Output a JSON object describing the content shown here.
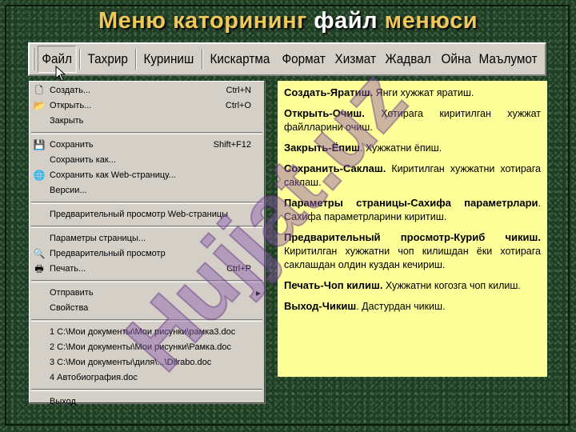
{
  "slide_title": {
    "part1": "Меню  каторининг",
    "part2": "файл",
    "part3": "менюси"
  },
  "menubar": {
    "items": [
      "Файл",
      "Тахрир",
      "Куриниш",
      "Кискартма",
      "Формат",
      "Хизмат",
      "Жадвал",
      "Ойна",
      "Маълумот"
    ]
  },
  "dropdown": {
    "groups": [
      [
        {
          "label": "Создать...",
          "shortcut": "Ctrl+N",
          "icon": "new-document-icon",
          "glyph": "🗋"
        },
        {
          "label": "Открыть...",
          "shortcut": "Ctrl+O",
          "icon": "open-folder-icon",
          "glyph": "📂"
        },
        {
          "label": "Закрыть",
          "shortcut": "",
          "icon": "",
          "glyph": ""
        }
      ],
      [
        {
          "label": "Сохранить",
          "shortcut": "Shift+F12",
          "icon": "save-disk-icon",
          "glyph": "💾"
        },
        {
          "label": "Сохранить как...",
          "shortcut": "",
          "icon": "",
          "glyph": ""
        },
        {
          "label": "Сохранить как Web-страницу...",
          "shortcut": "",
          "icon": "web-page-icon",
          "glyph": "🌐"
        },
        {
          "label": "Версии...",
          "shortcut": "",
          "icon": "",
          "glyph": ""
        }
      ],
      [
        {
          "label": "Предварительный просмотр Web-страницы",
          "shortcut": "",
          "icon": "",
          "glyph": ""
        }
      ],
      [
        {
          "label": "Параметры страницы...",
          "shortcut": "",
          "icon": "",
          "glyph": ""
        },
        {
          "label": "Предварительный просмотр",
          "shortcut": "",
          "icon": "print-preview-icon",
          "glyph": "🔍"
        },
        {
          "label": "Печать...",
          "shortcut": "Ctrl+P",
          "icon": "printer-icon",
          "glyph": "🖶"
        }
      ],
      [
        {
          "label": "Отправить",
          "shortcut": "",
          "icon": "",
          "glyph": "",
          "submenu": true
        },
        {
          "label": "Свойства",
          "shortcut": "",
          "icon": "",
          "glyph": ""
        }
      ],
      [
        {
          "label": "1 С:\\Мои документы\\Мои рисунки\\рамка3.doc",
          "shortcut": "",
          "icon": "",
          "glyph": ""
        },
        {
          "label": "2 С:\\Мои документы\\Мои рисунки\\Рамка.doc",
          "shortcut": "",
          "icon": "",
          "glyph": ""
        },
        {
          "label": "3 С:\\Мои документы\\диля\\...\\Dilrabo.doc",
          "shortcut": "",
          "icon": "",
          "glyph": ""
        },
        {
          "label": "4 Автобиография.doc",
          "shortcut": "",
          "icon": "",
          "glyph": ""
        }
      ],
      [
        {
          "label": "Выход",
          "shortcut": "",
          "icon": "",
          "glyph": ""
        }
      ]
    ]
  },
  "info": {
    "items": [
      {
        "term": "Создать-Яратиш.",
        "desc": " Янги  хужжат  яратиш."
      },
      {
        "term": "Открыть-Очиш.",
        "desc": " Хотирага  киритилган  хужжат  файлларини  очиш."
      },
      {
        "term": "Закрыть-Ёпиш",
        "desc": ". Хужжатни ёпиш."
      },
      {
        "term": "Сохранить-Саклаш.",
        "desc": "  Киритилган  хужжатни  хотирага  саклаш."
      },
      {
        "term": "Параметры страницы-Сахифа параметрлари",
        "desc": ". Сахифа  параметрларини  киритиш."
      },
      {
        "term": "Предварительный просмотр-Куриб чикиш.",
        "desc": " Киритилган  хужжатни  чоп килишдан  ёки хотирага саклашдан олдин куздан кечириш."
      },
      {
        "term": "Печать-Чоп килиш.",
        "desc": "  Хужжатни  когозга  чоп  килиш."
      },
      {
        "term": "Выход-Чикиш",
        "desc": ".  Дастурдан  чикиш."
      }
    ]
  },
  "watermark": {
    "text": "Hujjat.uz"
  },
  "colors": {
    "title_gold": "#f0c85a",
    "title_white": "#ffffff",
    "panel_yellow": "#ffff99",
    "menu_gray": "#d4d0c8"
  }
}
